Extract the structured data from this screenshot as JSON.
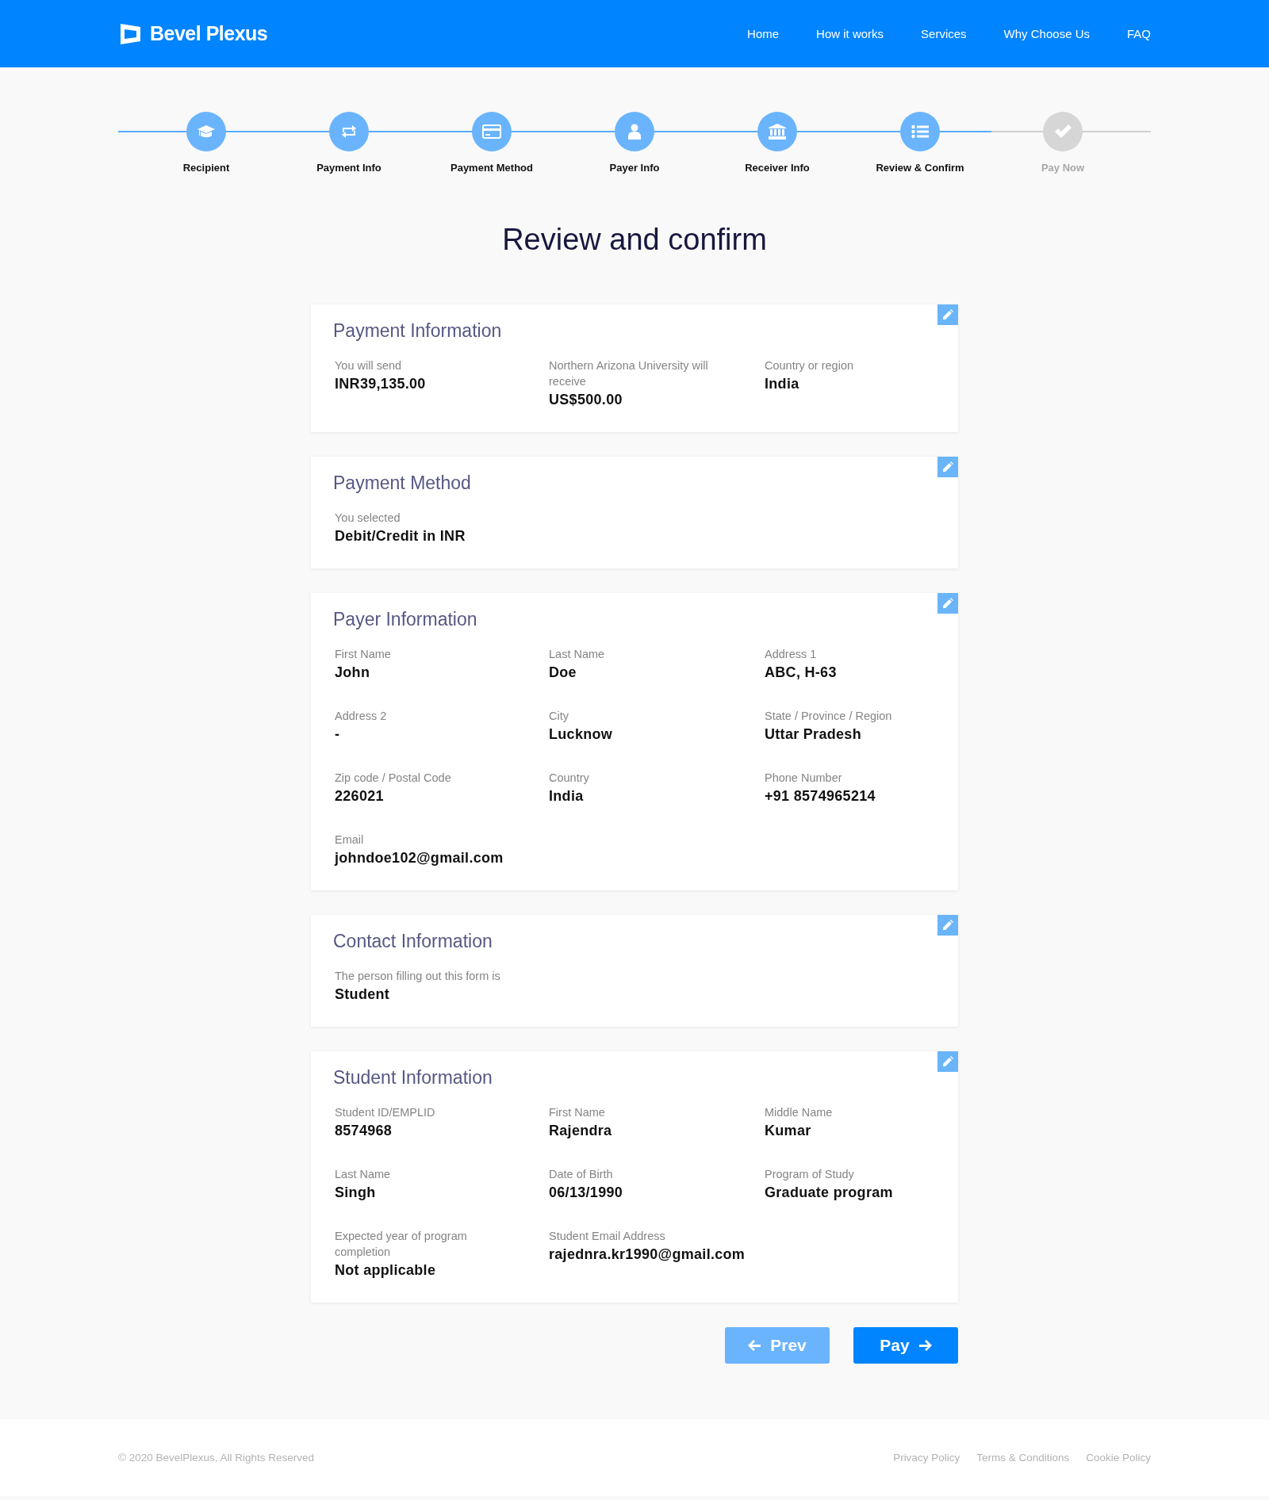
{
  "header": {
    "brand": "Bevel Plexus",
    "nav": [
      "Home",
      "How it works",
      "Services",
      "Why Choose Us",
      "FAQ"
    ]
  },
  "steps": [
    {
      "label": "Recipient",
      "done": true
    },
    {
      "label": "Payment Info",
      "done": true
    },
    {
      "label": "Payment Method",
      "done": true
    },
    {
      "label": "Payer Info",
      "done": true
    },
    {
      "label": "Receiver Info",
      "done": true
    },
    {
      "label": "Review & Confirm",
      "done": true
    },
    {
      "label": "Pay Now",
      "done": false
    }
  ],
  "title": "Review and confirm",
  "sections": [
    {
      "title": "Payment Information",
      "fields": [
        {
          "label": "You will send",
          "value": "INR39,135.00"
        },
        {
          "label": "Northern Arizona University will receive",
          "value": "US$500.00"
        },
        {
          "label": "Country or region",
          "value": "India"
        }
      ]
    },
    {
      "title": "Payment Method",
      "fields": [
        {
          "label": "You selected",
          "value": "Debit/Credit in INR"
        }
      ]
    },
    {
      "title": "Payer Information",
      "fields": [
        {
          "label": "First Name",
          "value": "John"
        },
        {
          "label": "Last Name",
          "value": "Doe"
        },
        {
          "label": "Address 1",
          "value": "ABC, H-63"
        },
        {
          "label": "Address 2",
          "value": "-"
        },
        {
          "label": "City",
          "value": "Lucknow"
        },
        {
          "label": "State / Province / Region",
          "value": "Uttar Pradesh"
        },
        {
          "label": "Zip code / Postal Code",
          "value": "226021"
        },
        {
          "label": "Country",
          "value": "India"
        },
        {
          "label": "Phone Number",
          "value": "+91 8574965214"
        },
        {
          "label": "Email",
          "value": "johndoe102@gmail.com"
        }
      ]
    },
    {
      "title": "Contact Information",
      "fields": [
        {
          "label": "The person filling out this form is",
          "value": "Student"
        }
      ]
    },
    {
      "title": "Student Information",
      "fields": [
        {
          "label": "Student ID/EMPLID",
          "value": "8574968"
        },
        {
          "label": "First Name",
          "value": "Rajendra"
        },
        {
          "label": "Middle Name",
          "value": "Kumar"
        },
        {
          "label": "Last Name",
          "value": "Singh"
        },
        {
          "label": "Date of Birth",
          "value": "06/13/1990"
        },
        {
          "label": "Program of Study",
          "value": "Graduate program"
        },
        {
          "label": "Expected year of program completion",
          "value": "Not applicable"
        },
        {
          "label": "Student Email Address",
          "value": "rajednra.kr1990@gmail.com"
        }
      ]
    }
  ],
  "buttons": [
    {
      "label": "Prev",
      "kind": "prev"
    },
    {
      "label": "Pay",
      "kind": "next"
    }
  ],
  "footer": {
    "copyright": "© 2020 BevelPlexus, All Rights Reserved",
    "links": [
      "Privacy Policy",
      "Terms & Conditions",
      "Cookie Policy"
    ]
  }
}
